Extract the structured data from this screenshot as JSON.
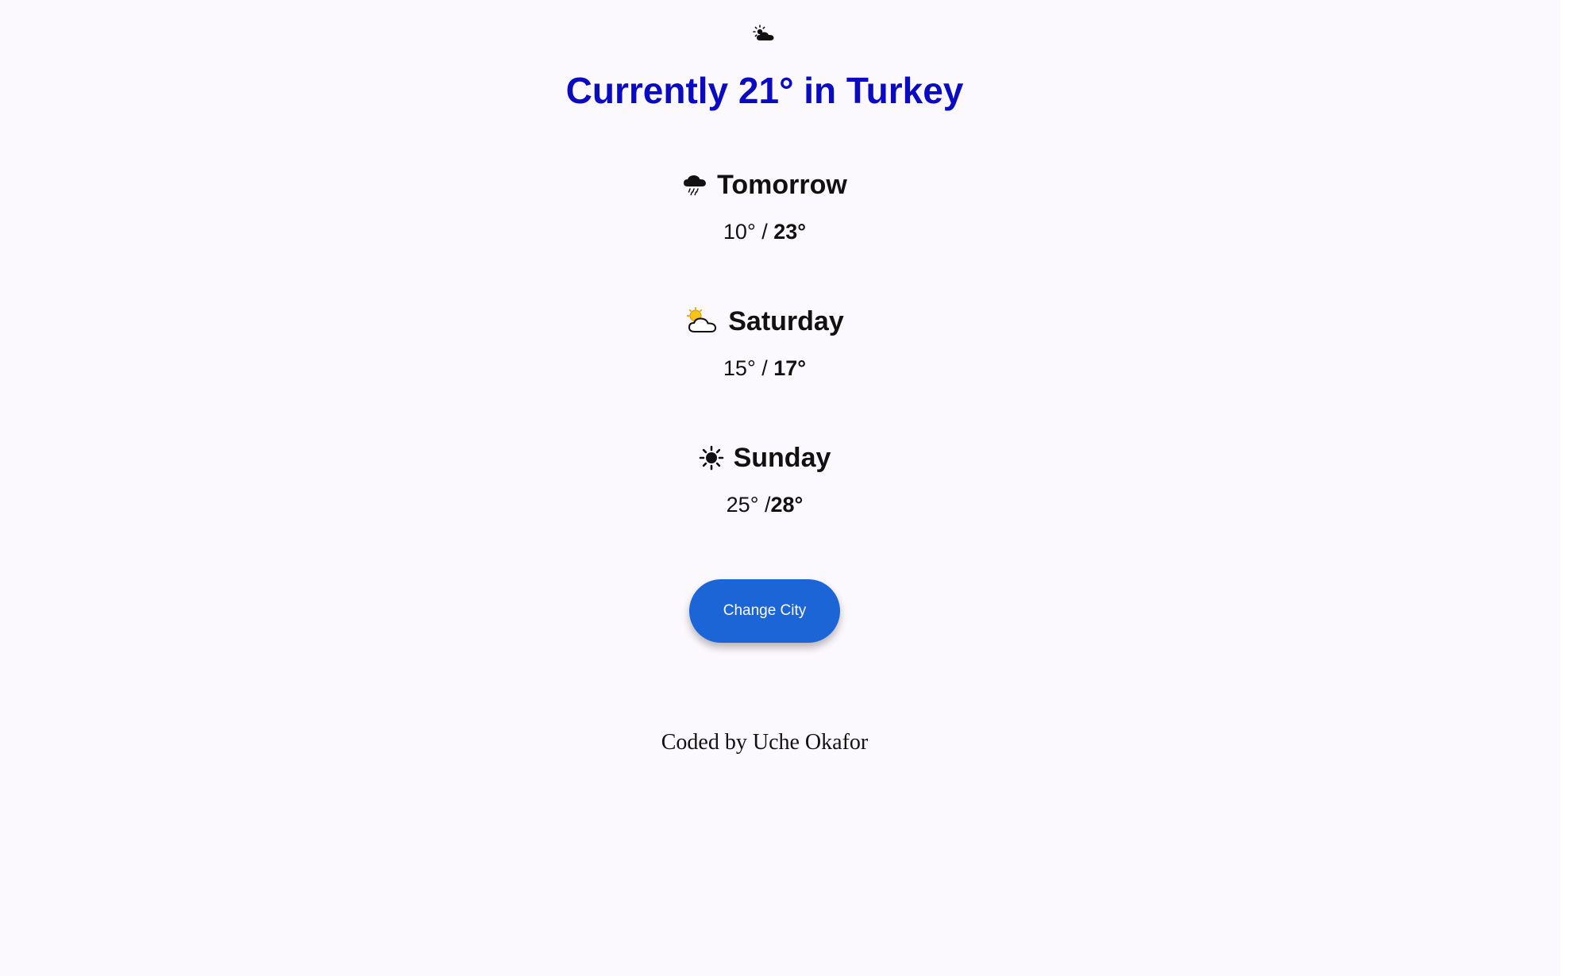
{
  "current": {
    "icon": "sun-behind-cloud-icon",
    "prefix": "Currently ",
    "temp": "21°",
    "mid": " in ",
    "location": "Turkey"
  },
  "forecast": [
    {
      "day": "Tomorrow",
      "icon": "rain-cloud-icon",
      "low": "10° / ",
      "high": "23°"
    },
    {
      "day": "Saturday",
      "icon": "sun-behind-cloud-icon",
      "low": "15° / ",
      "high": "17°"
    },
    {
      "day": "Sunday",
      "icon": "sun-icon",
      "low": "25° /",
      "high": "28°"
    }
  ],
  "button": {
    "label": "Change City"
  },
  "footer": {
    "text": "Coded by Uche Okafor"
  },
  "colors": {
    "headline": "#0a0ac2",
    "button": "#1b65d6",
    "background": "#fcf9fe"
  }
}
